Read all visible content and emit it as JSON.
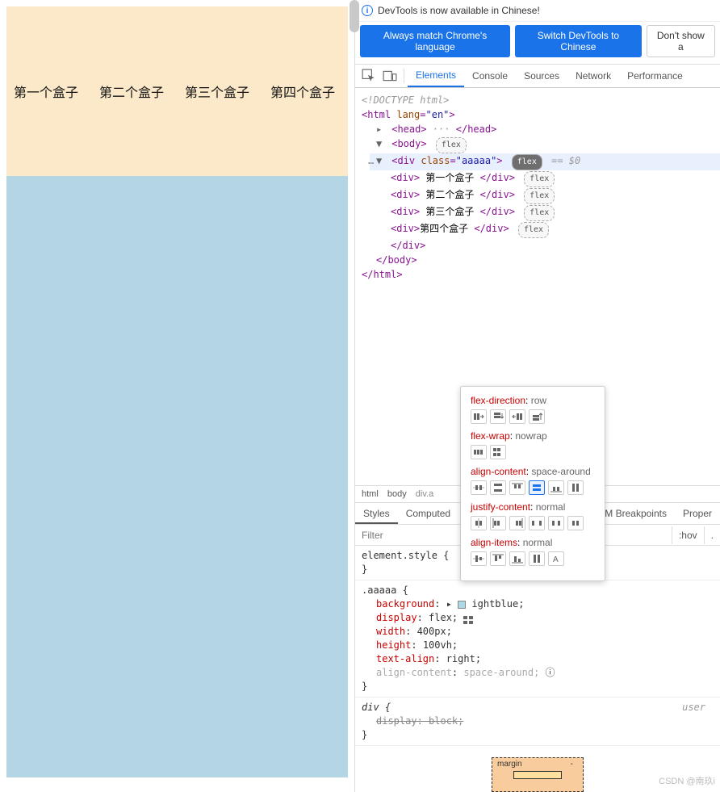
{
  "page": {
    "boxes": [
      "第一个盒子",
      "第二个盒子",
      "第三个盒子",
      "第四个盒子"
    ]
  },
  "notice": {
    "text": "DevTools is now available in Chinese!"
  },
  "buttons": {
    "match": "Always match Chrome's language",
    "switch": "Switch DevTools to Chinese",
    "dontshow": "Don't show a"
  },
  "tabs": {
    "elements": "Elements",
    "console": "Console",
    "sources": "Sources",
    "network": "Network",
    "performance": "Performance"
  },
  "dom": {
    "doctype": "<!DOCTYPE html>",
    "html_open": "<html lang=\"en\">",
    "head": "<head>",
    "head_dots": "···",
    "head_close": "</head>",
    "body_open": "<body>",
    "flex": "flex",
    "div_open": "<div class=\"aaaaa\">",
    "eq0": "== $0",
    "child_open": "<div>",
    "child_close": "</div>",
    "child1": " 第一个盒子 ",
    "child2": " 第二个盒子 ",
    "child3": " 第三个盒子 ",
    "child4": "第四个盒子 ",
    "div_close": "</div>",
    "body_close": "</body>",
    "html_close": "</html>"
  },
  "crumbs": {
    "html": "html",
    "body": "body",
    "div": "div.a"
  },
  "subtabs": {
    "styles": "Styles",
    "computed": "Computed",
    "breakpoints": "M Breakpoints",
    "properties": "Proper"
  },
  "filter": {
    "placeholder": "Filter",
    "hov": ":hov",
    "cls": "."
  },
  "styles": {
    "element_style": "element.style {",
    "close": "}",
    "rule_aaaaa": ".aaaaa {",
    "background": {
      "name": "background",
      "value": "ightblue;"
    },
    "display": {
      "name": "display",
      "value": "flex;"
    },
    "width": {
      "name": "width",
      "value": "400px;"
    },
    "height": {
      "name": "height",
      "value": "100vh;"
    },
    "text_align": {
      "name": "text-align",
      "value": "right;"
    },
    "align_content": {
      "name": "align-content",
      "value": "space-around;"
    },
    "rule_div": "div {",
    "display_block": {
      "name": "display",
      "value": "block;"
    },
    "user_agent": "user"
  },
  "boxmodel": {
    "margin": "margin",
    "dash": "-"
  },
  "popover": {
    "flex_direction": {
      "name": "flex-direction",
      "value": "row"
    },
    "flex_wrap": {
      "name": "flex-wrap",
      "value": "nowrap"
    },
    "align_content": {
      "name": "align-content",
      "value": "space-around"
    },
    "justify_content": {
      "name": "justify-content",
      "value": "normal"
    },
    "align_items": {
      "name": "align-items",
      "value": "normal"
    }
  },
  "watermark": "CSDN @南玖i"
}
